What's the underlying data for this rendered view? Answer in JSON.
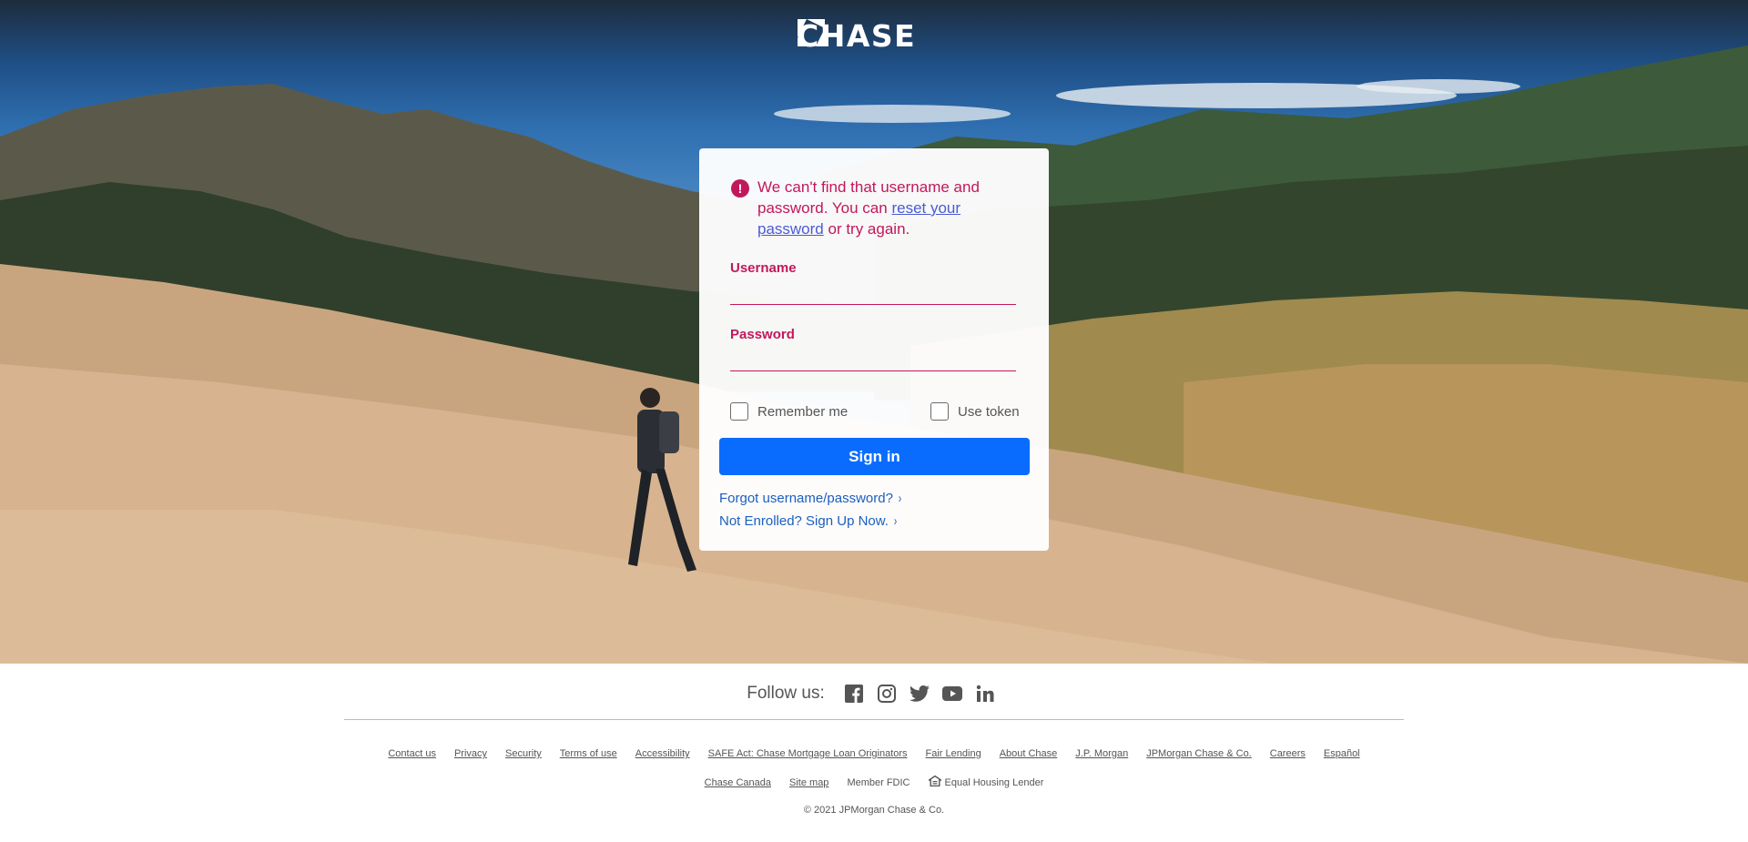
{
  "brand": {
    "name": "CHASE",
    "logo_icon": "chase-octagon-icon"
  },
  "login": {
    "error": {
      "icon": "alert-icon",
      "prefix": "We can't find that username and password. You can ",
      "link_text": "reset your password",
      "suffix": " or try again."
    },
    "username_label": "Username",
    "username_value": "",
    "password_label": "Password",
    "password_value": "",
    "remember_label": "Remember me",
    "remember_checked": false,
    "token_label": "Use token",
    "token_checked": false,
    "signin_label": "Sign in",
    "forgot_link": "Forgot username/password?",
    "enroll_link": "Not Enrolled? Sign Up Now.",
    "chevron": "›"
  },
  "footer": {
    "follow_label": "Follow us:",
    "social": [
      "facebook-icon",
      "instagram-icon",
      "twitter-icon",
      "youtube-icon",
      "linkedin-icon"
    ],
    "links_row1": [
      "Contact us",
      "Privacy",
      "Security",
      "Terms of use",
      "Accessibility",
      "SAFE Act: Chase Mortgage Loan Originators",
      "Fair Lending",
      "About Chase",
      "J.P. Morgan",
      "JPMorgan Chase & Co.",
      "Careers",
      "Español"
    ],
    "links_row2": [
      "Chase Canada",
      "Site map"
    ],
    "fdic": "Member FDIC",
    "equal_housing": "Equal Housing Lender",
    "copyright": "© 2021 JPMorgan Chase & Co."
  },
  "colors": {
    "accent": "#c2185b",
    "link": "#1a5fbf",
    "button": "#0a6cff"
  }
}
